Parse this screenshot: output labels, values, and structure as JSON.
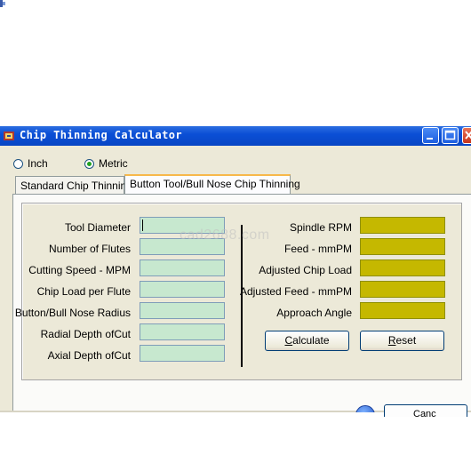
{
  "window": {
    "title": "Chip Thinning Calculator"
  },
  "units": [
    {
      "label": "Inch",
      "selected": false
    },
    {
      "label": "Metric",
      "selected": true
    }
  ],
  "tabs": [
    {
      "label": "Standard Chip Thinning",
      "active": false
    },
    {
      "label": "Button Tool/Bull Nose Chip Thinning",
      "active": true
    }
  ],
  "inputs": [
    {
      "label": "Tool Diameter",
      "value": ""
    },
    {
      "label": "Number of Flutes",
      "value": ""
    },
    {
      "label": "Cutting Speed - MPM",
      "value": ""
    },
    {
      "label": "Chip Load per Flute",
      "value": ""
    },
    {
      "label": "Button/Bull Nose Radius",
      "value": ""
    },
    {
      "label": "Radial Depth ofCut",
      "value": ""
    },
    {
      "label": "Axial Depth ofCut",
      "value": ""
    }
  ],
  "outputs": [
    {
      "label": "Spindle RPM",
      "value": ""
    },
    {
      "label": "Feed - mmPM",
      "value": ""
    },
    {
      "label": "Adjusted Chip Load",
      "value": ""
    },
    {
      "label": "Adjusted Feed - mmPM",
      "value": ""
    },
    {
      "label": "Approach Angle",
      "value": ""
    }
  ],
  "buttons": {
    "calculate": {
      "mnemonic": "C",
      "rest": "alculate"
    },
    "reset": {
      "mnemonic": "R",
      "rest": "eset"
    },
    "bottom_partial": "Canc"
  },
  "watermark": "cad2688.com",
  "colors": {
    "title_bar": "#0b4fd6",
    "input_bg": "#c7e8cf",
    "output_bg": "#c5b800",
    "window_bg": "#ece9d8",
    "radio_dot": "#21a121"
  },
  "icons": {
    "app": "app-icon",
    "help": "help-icon"
  }
}
